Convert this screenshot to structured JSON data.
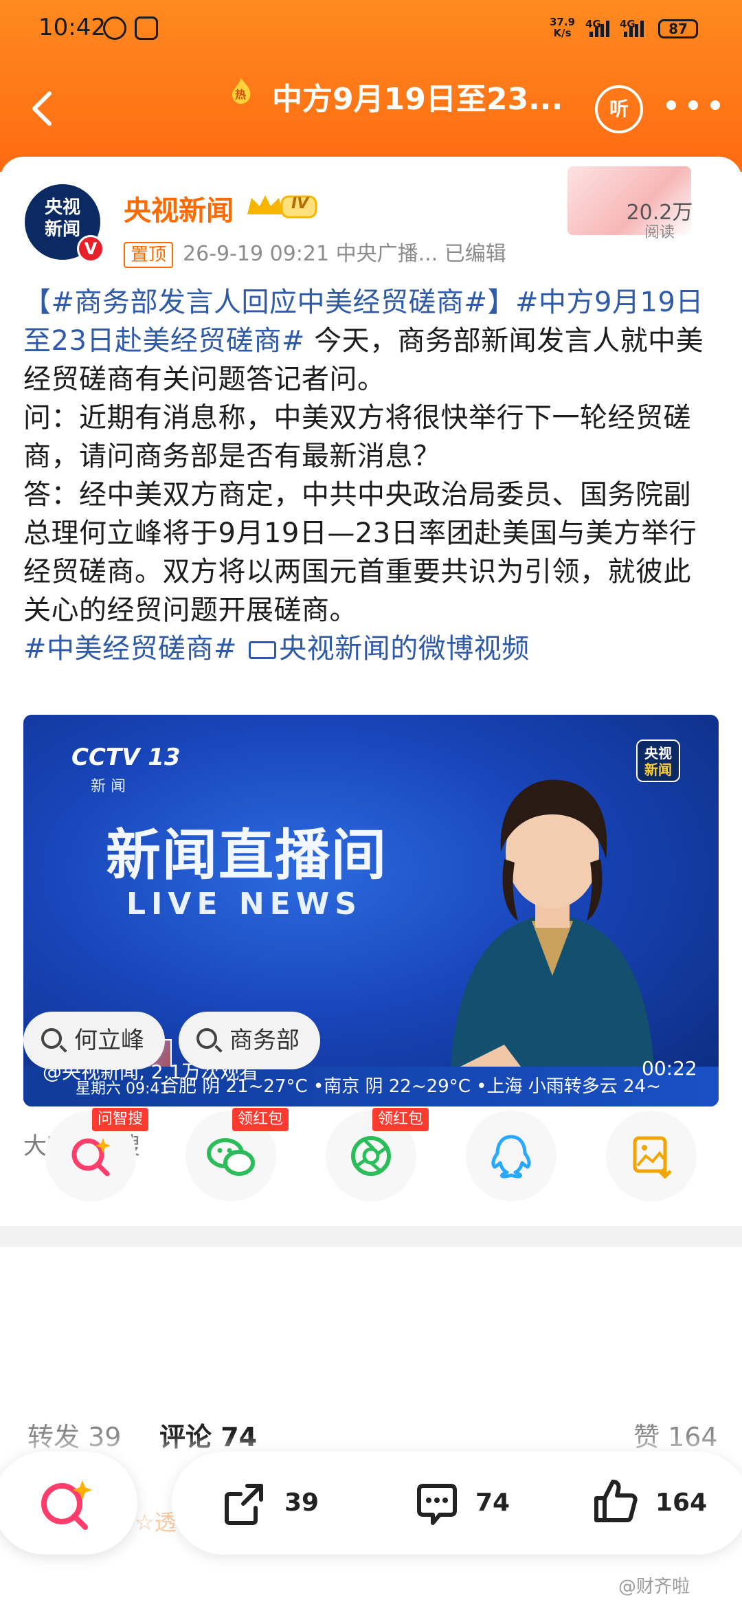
{
  "status_bar": {
    "time": "10:42",
    "network_speed": "37.9",
    "network_unit": "K/s",
    "signal1": "4G",
    "signal2": "4G",
    "battery": "87"
  },
  "navbar": {
    "hot_badge": "热",
    "title": "中方9月19日至23...",
    "listen_label": "听"
  },
  "post": {
    "author_name": "央视新闻",
    "avatar_line1": "央视",
    "avatar_line2": "新闻",
    "verified": "V",
    "level_badge": "IV",
    "pin_label": "置顶",
    "meta": "26-9-19 09:21  中央广播...  已编辑",
    "views_count": "20.2万",
    "views_label": "阅读",
    "body": {
      "tag1": "【#商务部发言人回应中美经贸磋商#】",
      "tag2": "#中方9月19日至23日赴美经贸磋商#",
      "intro": " 今天，商务部新闻发言人就中美经贸磋商有关问题答记者问。",
      "q": "问：近期有消息称，中美双方将很快举行下一轮经贸磋商，请问商务部是否有最新消息？",
      "a": "答：经中美双方商定，中共中央政治局委员、国务院副总理何立峰将于9月19日—23日率团赴美国与美方举行经贸磋商。双方将以两国元首重要共识为引领，就彼此关心的经贸问题开展磋商。",
      "tag3": "#中美经贸磋商#",
      "video_link": "央视新闻的微博视频"
    }
  },
  "video": {
    "channel_logo": "CCTV 13",
    "channel_sub": "新 闻",
    "corner_logo_1": "央视",
    "corner_logo_2": "新闻",
    "program_cn": "新闻直播间",
    "program_en": "LIVE NEWS",
    "ticker": "合肥 阴 21~27°C  •南京 阴 22~29°C  •上海 小雨转多云 24~",
    "thumb_label": "星期六 09:41",
    "views": "@央视新闻, 2.1万次观看",
    "duration": "00:22"
  },
  "search": {
    "title": "大家都在搜",
    "chips": [
      "何立峰",
      "商务部"
    ]
  },
  "share_row": {
    "tag_ai": "问智搜",
    "tag_wechat": "领红包",
    "tag_moments": "领红包"
  },
  "tabs": {
    "repost": "转发 39",
    "comment": "评论 74",
    "like": "赞 164"
  },
  "actions": {
    "repost_count": "39",
    "comment_count": "74",
    "like_count": "164"
  },
  "hint_ghost": "☆透明",
  "watermark": "@财齐啦",
  "colors": {
    "brand_orange": "#ff6a12",
    "tag_blue": "#2f5aa8",
    "author_orange": "#ff6a00",
    "red_tag": "#ff3b30"
  }
}
